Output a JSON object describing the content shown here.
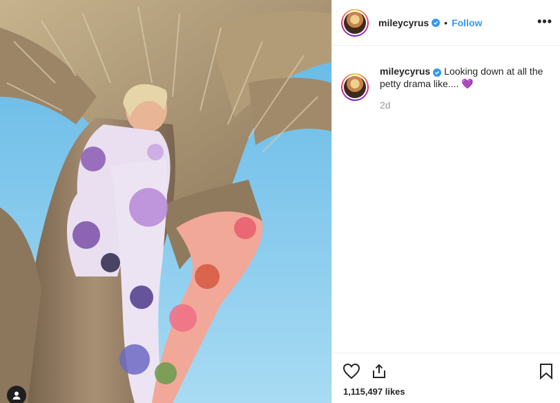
{
  "post": {
    "username": "mileycyrus",
    "follow_label": "Follow",
    "separator": "•",
    "more_label": "•••",
    "caption_username": "mileycyrus",
    "caption_text": "Looking down at all the petty drama like....",
    "caption_emoji": "💜",
    "time_ago": "2d",
    "likes": "1,115,497 likes"
  },
  "icons": {
    "verified": "verified-badge-icon",
    "like": "heart-icon",
    "share": "share-icon",
    "save": "bookmark-icon",
    "tag": "user-tag-icon"
  },
  "colors": {
    "accent": "#3897f0",
    "text": "#262626",
    "muted": "#999999",
    "sky": "#7cc4ea"
  }
}
